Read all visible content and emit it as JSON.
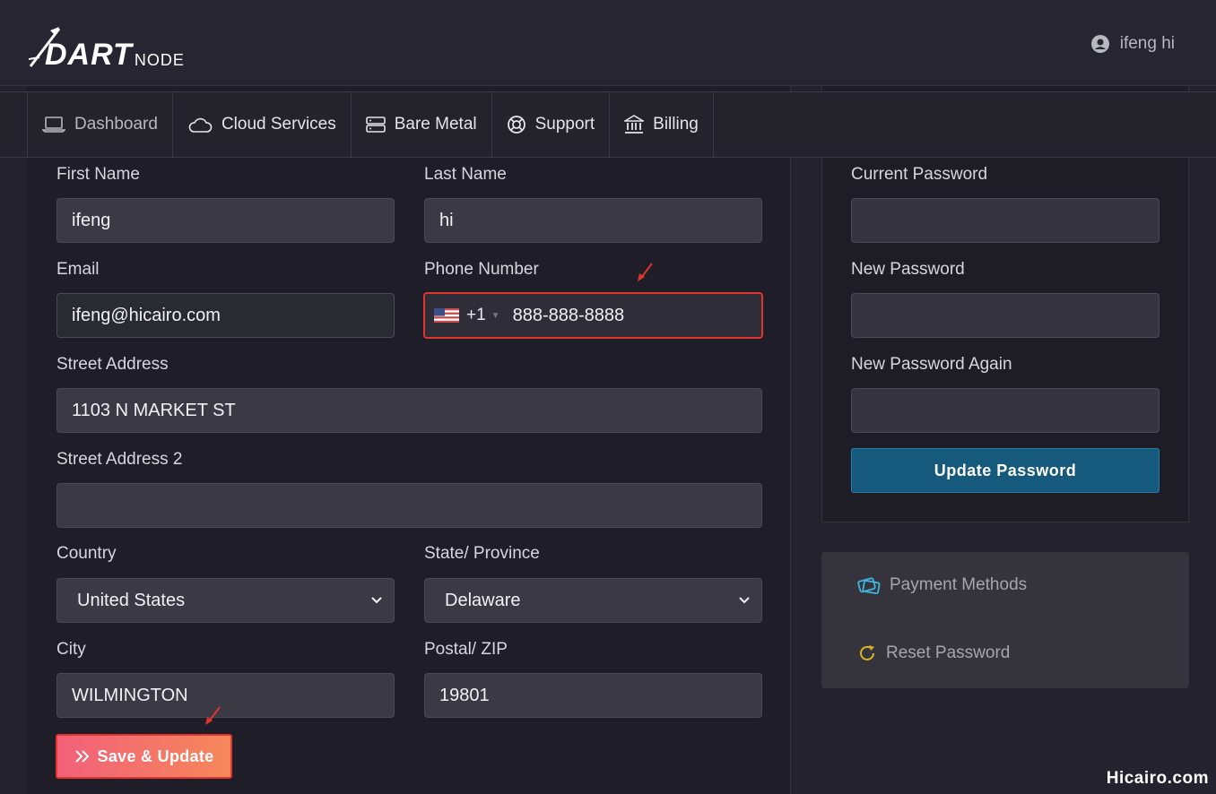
{
  "brand": {
    "logo_main": "DART",
    "logo_sub": "NODE"
  },
  "user": {
    "name": "ifeng hi"
  },
  "nav": [
    {
      "label": "Dashboard",
      "icon": "laptop-icon"
    },
    {
      "label": "Cloud Services",
      "icon": "cloud-icon"
    },
    {
      "label": "Bare Metal",
      "icon": "server-icon"
    },
    {
      "label": "Support",
      "icon": "lifebuoy-icon"
    },
    {
      "label": "Billing",
      "icon": "bank-icon"
    }
  ],
  "profile_form": {
    "first_name": {
      "label": "First Name",
      "value": "ifeng"
    },
    "last_name": {
      "label": "Last Name",
      "value": "hi"
    },
    "email": {
      "label": "Email",
      "value": "ifeng@hicairo.com"
    },
    "phone": {
      "label": "Phone Number",
      "dial_code": "+1",
      "value": "888-888-8888"
    },
    "street1": {
      "label": "Street Address",
      "value": "1103 N MARKET ST"
    },
    "street2": {
      "label": "Street Address 2",
      "value": ""
    },
    "country": {
      "label": "Country",
      "value": "United States"
    },
    "state": {
      "label": "State/ Province",
      "value": "Delaware"
    },
    "city": {
      "label": "City",
      "value": "WILMINGTON"
    },
    "zip": {
      "label": "Postal/ ZIP",
      "value": "19801"
    },
    "save_button": "Save & Update"
  },
  "password_form": {
    "current": {
      "label": "Current Password",
      "value": ""
    },
    "new": {
      "label": "New Password",
      "value": ""
    },
    "again": {
      "label": "New Password Again",
      "value": ""
    },
    "submit": "Update Password"
  },
  "side_menu": [
    {
      "label": "Payment Methods",
      "icon": "credit-cards-icon"
    },
    {
      "label": "Reset Password",
      "icon": "refresh-icon"
    }
  ],
  "watermark": "Hicairo.com",
  "colors": {
    "accent_red": "#e0342f",
    "save_gradient_start": "#f2607a",
    "save_gradient_end": "#f6885a",
    "update_button": "#155a7c"
  }
}
